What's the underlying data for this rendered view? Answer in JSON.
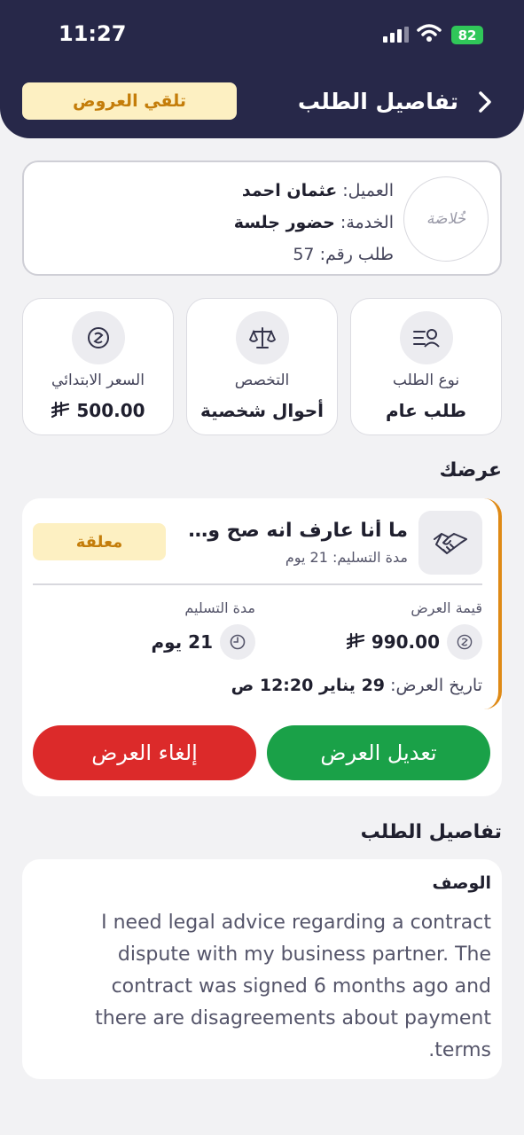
{
  "status_bar": {
    "time": "11:27",
    "battery": "82"
  },
  "header": {
    "title": "تفاصيل الطلب",
    "offers_button": "تلقي العروض"
  },
  "client": {
    "logo_text": "خُلاصَة",
    "client_label": "العميل:",
    "client_name": "عثمان احمد",
    "service_label": "الخدمة:",
    "service_name": "حضور جلسة",
    "order_label": "طلب رقم:",
    "order_number": "57"
  },
  "info_cards": [
    {
      "label": "نوع الطلب",
      "value": "طلب عام",
      "icon": "request-type-icon"
    },
    {
      "label": "التخصص",
      "value": "أحوال شخصية",
      "icon": "scales-icon"
    },
    {
      "label": "السعر الابتدائي",
      "value": "500.00",
      "icon": "currency-icon"
    }
  ],
  "offer_section": {
    "title": "عرضك"
  },
  "offer": {
    "title": "ما أنا عارف انه صح ولا غلط",
    "delivery_line": "مدة التسليم: 21 يوم",
    "status": "معلقة",
    "value_label": "قيمة العرض",
    "value": "990.00",
    "duration_label": "مدة التسليم",
    "duration": "21 يوم",
    "date_label": "تاريخ العرض:",
    "date_value": "29 يناير 12:20 ص",
    "edit_button": "تعديل العرض",
    "cancel_button": "إلغاء العرض"
  },
  "details_section": {
    "title": "تفاصيل الطلب",
    "description_label": "الوصف",
    "description": "I need legal advice regarding a contract dispute with my business partner. The contract was signed 6 months ago and there are disagreements about payment terms."
  },
  "colors": {
    "header_bg": "#272849",
    "accent_orange": "#df8a16",
    "edit_green": "#1aa148",
    "cancel_red": "#dc2a2a",
    "badge_bg": "#fdf0c2"
  }
}
